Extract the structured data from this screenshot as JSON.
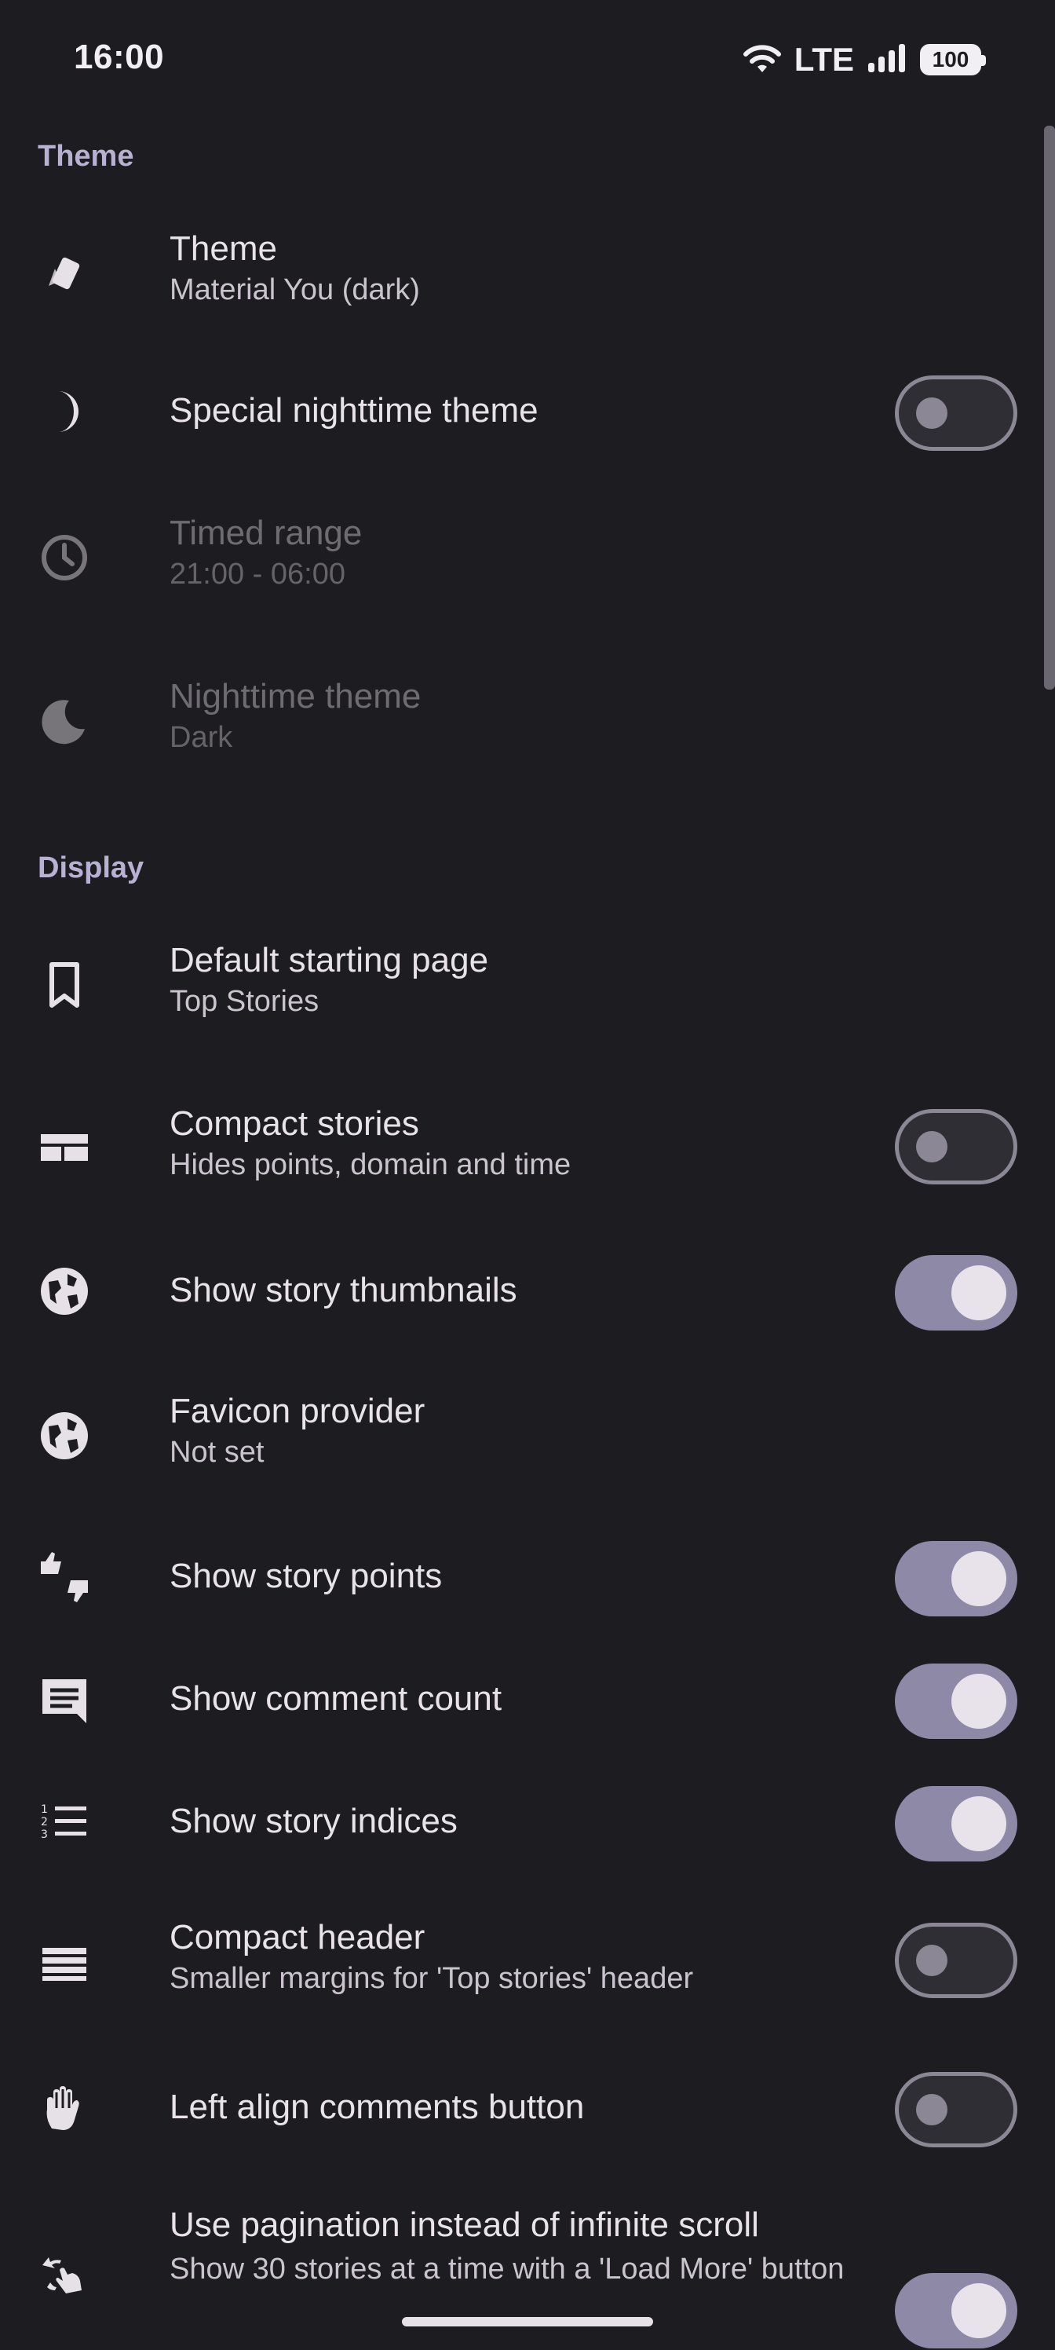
{
  "status_bar": {
    "time": "16:00",
    "network": "LTE",
    "battery": "100",
    "icons": [
      "wifi-icon",
      "signal-icon",
      "battery-icon"
    ]
  },
  "sections": {
    "theme": "Theme",
    "display": "Display"
  },
  "settings": {
    "theme": {
      "title": "Theme",
      "summary": "Material You (dark)",
      "icon": "palette-cards-icon"
    },
    "special_night": {
      "title": "Special nighttime theme",
      "switch": false,
      "icon": "half-moon-icon"
    },
    "timed_range": {
      "title": "Timed range",
      "summary": "21:00 - 06:00",
      "icon": "clock-icon",
      "enabled": false
    },
    "night_theme": {
      "title": "Nighttime theme",
      "summary": "Dark",
      "icon": "moon-icon",
      "enabled": false
    },
    "default_page": {
      "title": "Default starting page",
      "summary": "Top Stories",
      "icon": "bookmark-icon"
    },
    "compact_stories": {
      "title": "Compact stories",
      "summary": "Hides points, domain and time",
      "switch": false,
      "icon": "compact-grid-icon"
    },
    "thumbnails": {
      "title": "Show story thumbnails",
      "switch": true,
      "icon": "globe-icon"
    },
    "favicon": {
      "title": "Favicon provider",
      "summary": "Not set",
      "icon": "globe-icon"
    },
    "points": {
      "title": "Show story points",
      "switch": true,
      "icon": "thumbs-up-down-icon"
    },
    "comment_count": {
      "title": "Show comment count",
      "switch": true,
      "icon": "comment-icon"
    },
    "indices": {
      "title": "Show story indices",
      "switch": true,
      "icon": "numbered-list-icon"
    },
    "compact_header": {
      "title": "Compact header",
      "summary": "Smaller margins for 'Top stories' header",
      "switch": false,
      "icon": "compact-rows-icon"
    },
    "left_align": {
      "title": "Left align comments button",
      "switch": false,
      "icon": "hand-icon"
    },
    "pagination": {
      "title": "Use pagination instead of infinite scroll",
      "summary": "Show 30 stories at a time with a 'Load More' button",
      "switch": true,
      "icon": "swipe-icon"
    }
  },
  "colors": {
    "background": "#1d1c21",
    "accent": "#b8b1d2",
    "switch_on": "#8d89a6"
  }
}
